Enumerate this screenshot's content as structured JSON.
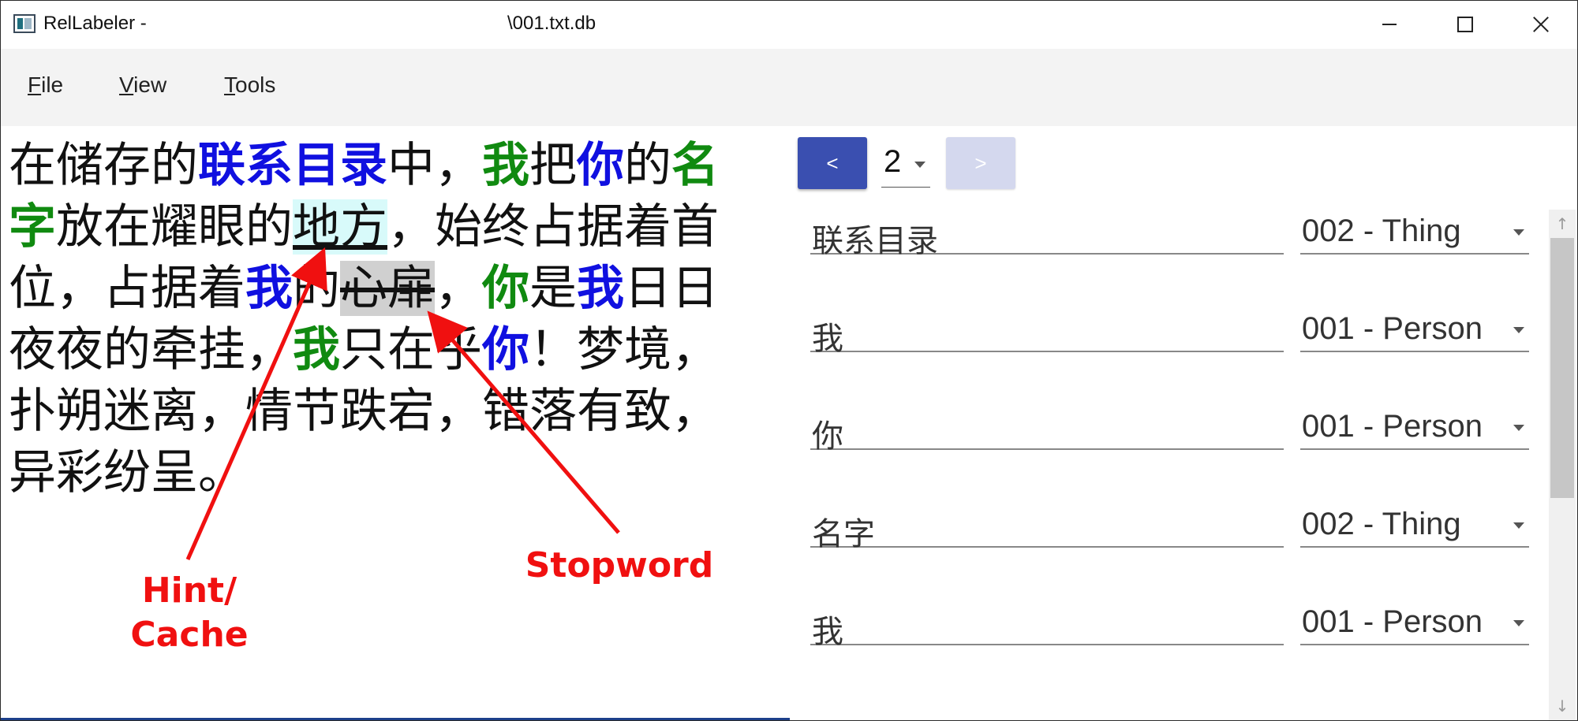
{
  "window": {
    "app_title": "RelLabeler -",
    "file_path": "\\001.txt.db",
    "controls": {
      "minimize": "minimize",
      "maximize": "maximize",
      "close": "close"
    }
  },
  "menu": {
    "file": {
      "mnemonic": "F",
      "rest": "ile"
    },
    "view": {
      "mnemonic": "V",
      "rest": "iew"
    },
    "tools": {
      "mnemonic": "T",
      "rest": "ools"
    }
  },
  "text": {
    "segments": [
      {
        "text": "在储存的",
        "style": "plain"
      },
      {
        "text": "联系目录",
        "style": "entity-blue"
      },
      {
        "text": "中，",
        "style": "plain"
      },
      {
        "text": "我",
        "style": "entity-green"
      },
      {
        "text": "把",
        "style": "plain"
      },
      {
        "text": "你",
        "style": "entity-blue"
      },
      {
        "text": "的",
        "style": "plain"
      },
      {
        "text": "名字",
        "style": "entity-green"
      },
      {
        "text": "放在耀眼的",
        "style": "plain"
      },
      {
        "text": "地方",
        "style": "hint"
      },
      {
        "text": "，始终占据着首位，占据着",
        "style": "plain"
      },
      {
        "text": "我",
        "style": "entity-blue"
      },
      {
        "text": "的",
        "style": "plain"
      },
      {
        "text": "心扉",
        "style": "stopword"
      },
      {
        "text": "，",
        "style": "plain"
      },
      {
        "text": "你",
        "style": "entity-green"
      },
      {
        "text": "是",
        "style": "plain"
      },
      {
        "text": "我",
        "style": "entity-blue"
      },
      {
        "text": "日日夜夜的牵挂，",
        "style": "plain"
      },
      {
        "text": "我",
        "style": "entity-green"
      },
      {
        "text": "只在乎",
        "style": "plain"
      },
      {
        "text": "你",
        "style": "entity-blue"
      },
      {
        "text": "！梦境，扑朔迷离，情节跌宕，错落有致，异彩纷呈。",
        "style": "plain"
      }
    ]
  },
  "annotations_overlay": {
    "hint_label": "Hint/\nCache",
    "stopword_label": "Stopword",
    "color": "#f01010"
  },
  "navigator": {
    "prev_label": "<",
    "next_label": ">",
    "page": "2"
  },
  "entities": [
    {
      "word": "联系目录",
      "type": "002 - Thing"
    },
    {
      "word": "我",
      "type": "001 - Person"
    },
    {
      "word": "你",
      "type": "001 - Person"
    },
    {
      "word": "名字",
      "type": "002 - Thing"
    },
    {
      "word": "我",
      "type": "001 - Person"
    }
  ],
  "scrollbar": {
    "up": "↑",
    "down": "↓"
  },
  "colors": {
    "entity_blue": "#1010e0",
    "entity_green": "#108a10",
    "hint_bg": "#d8fafa",
    "stopword_bg": "#d0d0d0",
    "primary_button": "#3a4fb0",
    "disabled_button": "#d4d8ee"
  }
}
